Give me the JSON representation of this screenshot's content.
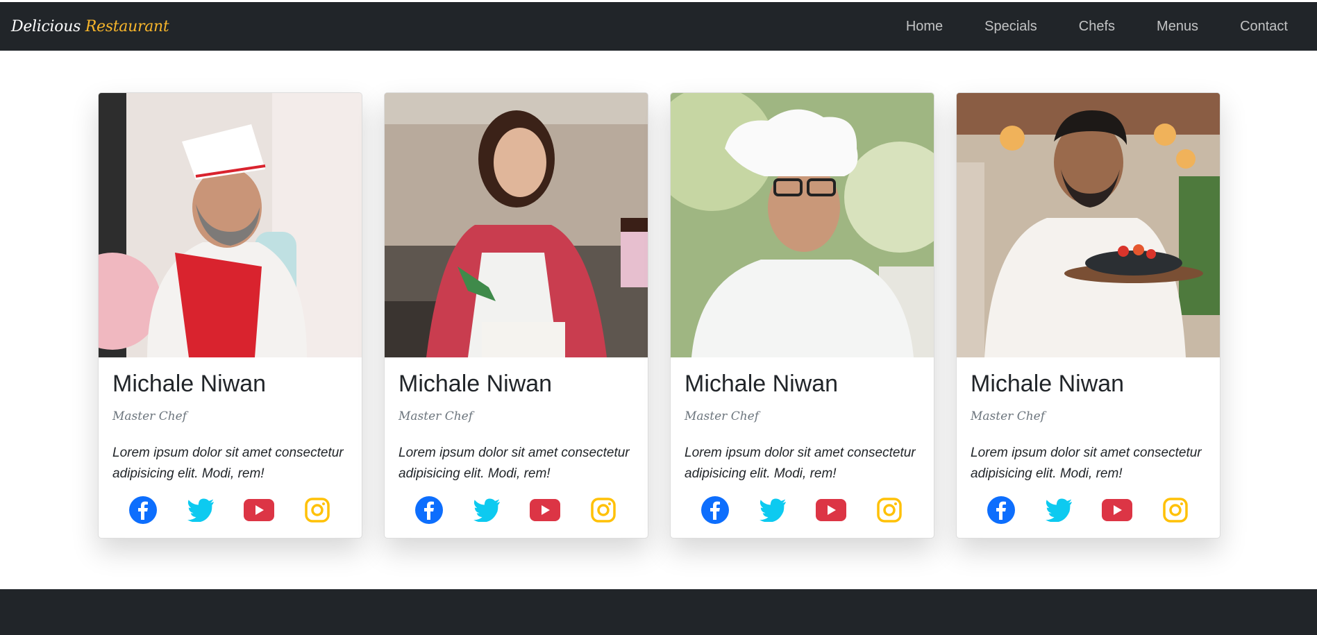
{
  "brand": {
    "part1": "Delicious",
    "part2": "Restaurant"
  },
  "nav": [
    "Home",
    "Specials",
    "Chefs",
    "Menus",
    "Contact"
  ],
  "colors": {
    "navbar": "#212529",
    "brand_accent": "#f7b52b",
    "facebook": "#0d6efd",
    "twitter": "#0dcaf0",
    "youtube": "#dc3545",
    "instagram": "#ffc107"
  },
  "chefs": [
    {
      "name": "Michale Niwan",
      "role": "Master Chef",
      "text": "Lorem ipsum dolor sit amet consectetur adipisicing elit. Modi, rem!",
      "photo": "chef-photo-1"
    },
    {
      "name": "Michale Niwan",
      "role": "Master Chef",
      "text": "Lorem ipsum dolor sit amet consectetur adipisicing elit. Modi, rem!",
      "photo": "chef-photo-2"
    },
    {
      "name": "Michale Niwan",
      "role": "Master Chef",
      "text": "Lorem ipsum dolor sit amet consectetur adipisicing elit. Modi, rem!",
      "photo": "chef-photo-3"
    },
    {
      "name": "Michale Niwan",
      "role": "Master Chef",
      "text": "Lorem ipsum dolor sit amet consectetur adipisicing elit. Modi, rem!",
      "photo": "chef-photo-4"
    }
  ],
  "social_icons": [
    "facebook-icon",
    "twitter-icon",
    "youtube-icon",
    "instagram-icon"
  ]
}
